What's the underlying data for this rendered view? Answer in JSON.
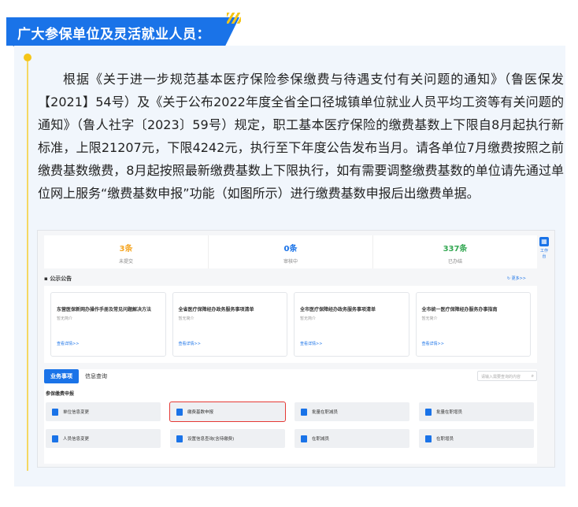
{
  "header": {
    "title": "广大参保单位及灵活就业人员："
  },
  "article": {
    "paragraph": "根据《关于进一步规范基本医疗保险参保缴费与待遇支付有关问题的通知》（鲁医保发【2021】54号）及《关于公布2022年度全省全口径城镇单位就业人员平均工资等有关问题的通知》（鲁人社字〔2023〕59号）规定，职工基本医疗保险的缴费基数上下限自8月起执行新标准，上限21207元，下限4242元，执行至下年度公告发布当月。请各单位7月缴费按照之前缴费基数缴费，8月起按照最新缴费基数上下限执行，如有需要调整缴费基数的单位请先通过单位网上服务“缴费基数申报”功能（如图所示）进行缴费基数申报后出缴费单据。"
  },
  "screenshot": {
    "stats": [
      {
        "value": "3条",
        "label": "未提交",
        "color": "#f5a623"
      },
      {
        "value": "0条",
        "label": "审核中",
        "color": "#1a73e8"
      },
      {
        "value": "337条",
        "label": "已办结",
        "color": "#34a853"
      }
    ],
    "tool_label": "工作台",
    "notice": {
      "title": "公示公告",
      "more": "更多>>"
    },
    "notices": [
      {
        "title": "东营医保新网办操作手册及常见问题解决方法",
        "sub": "暂无简介",
        "link": "查看详情>>"
      },
      {
        "title": "全省医疗保障经办政务服务事项清单",
        "sub": "暂无简介",
        "link": "查看详情>>"
      },
      {
        "title": "全市医疗保障经办政务服务事项清单",
        "sub": "暂无简介",
        "link": "查看详情>>"
      },
      {
        "title": "全市统一医疗保障经办服务办事指南",
        "sub": "暂无简介",
        "link": "查看详情>>"
      }
    ],
    "tabs": [
      "业务事项",
      "信息查询"
    ],
    "search_placeholder": "请输入需要查询的内容",
    "group_title": "参保缴费申报",
    "items": [
      "单位信息变更",
      "缴费基数申报",
      "批量在职减员",
      "批量在职增员",
      "人员信息变更",
      "设置信息查询(含待缴费)",
      "在职减员",
      "在职增员"
    ]
  }
}
